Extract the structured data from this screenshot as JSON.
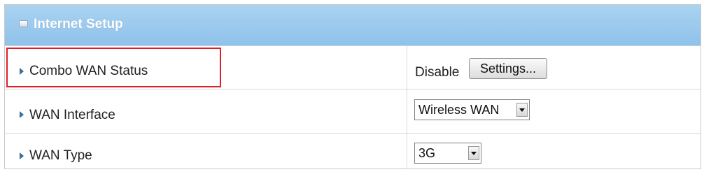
{
  "header": {
    "title": "Internet Setup",
    "background_color": "#9fcef0"
  },
  "rows": [
    {
      "label": "Combo WAN Status",
      "status": "Disable",
      "button_label": "Settings..."
    },
    {
      "label": "WAN Interface",
      "selected": "Wireless WAN"
    },
    {
      "label": "WAN Type",
      "selected": "3G"
    }
  ],
  "highlight": {
    "color": "#e01e2a"
  }
}
